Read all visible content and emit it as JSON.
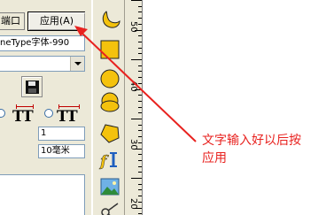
{
  "dialog": {
    "port_button": "端口",
    "apply_button": "应用(A)",
    "font_name": "neType字体-990",
    "size_value": "1",
    "spacing_value": "10毫米"
  },
  "toolbar": {
    "tools": [
      "moon-shape-icon",
      "square-shape-icon",
      "circle-shape-icon",
      "circle-shape-icon",
      "ellipse-shape-icon",
      "pentagon-shape-icon",
      "font-i-icon",
      "image-icon",
      "scissors-icon"
    ]
  },
  "ruler": {
    "labels": [
      "50",
      "40",
      "30",
      "20"
    ]
  },
  "annotation": {
    "line1": "文字输入好以后按",
    "line2": "应用",
    "color": "#e8221f"
  }
}
